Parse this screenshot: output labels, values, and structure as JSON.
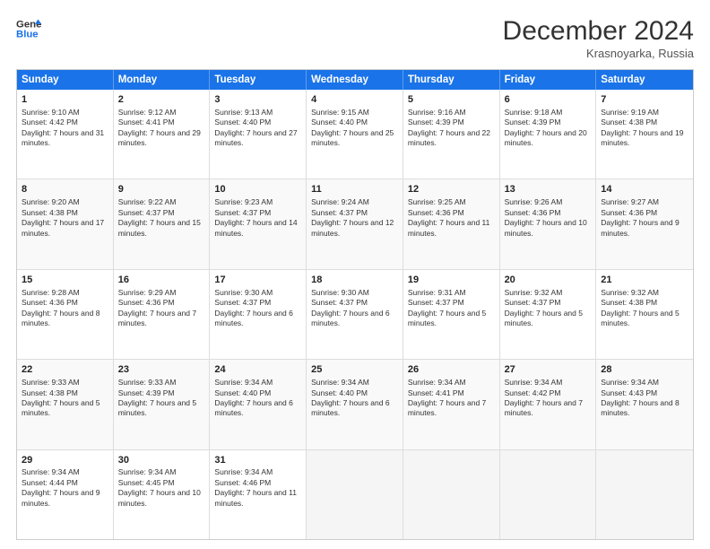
{
  "header": {
    "logo_line1": "General",
    "logo_line2": "Blue",
    "month": "December 2024",
    "location": "Krasnoyarka, Russia"
  },
  "days_of_week": [
    "Sunday",
    "Monday",
    "Tuesday",
    "Wednesday",
    "Thursday",
    "Friday",
    "Saturday"
  ],
  "weeks": [
    [
      {
        "day": "1",
        "sunrise": "Sunrise: 9:10 AM",
        "sunset": "Sunset: 4:42 PM",
        "daylight": "Daylight: 7 hours and 31 minutes."
      },
      {
        "day": "2",
        "sunrise": "Sunrise: 9:12 AM",
        "sunset": "Sunset: 4:41 PM",
        "daylight": "Daylight: 7 hours and 29 minutes."
      },
      {
        "day": "3",
        "sunrise": "Sunrise: 9:13 AM",
        "sunset": "Sunset: 4:40 PM",
        "daylight": "Daylight: 7 hours and 27 minutes."
      },
      {
        "day": "4",
        "sunrise": "Sunrise: 9:15 AM",
        "sunset": "Sunset: 4:40 PM",
        "daylight": "Daylight: 7 hours and 25 minutes."
      },
      {
        "day": "5",
        "sunrise": "Sunrise: 9:16 AM",
        "sunset": "Sunset: 4:39 PM",
        "daylight": "Daylight: 7 hours and 22 minutes."
      },
      {
        "day": "6",
        "sunrise": "Sunrise: 9:18 AM",
        "sunset": "Sunset: 4:39 PM",
        "daylight": "Daylight: 7 hours and 20 minutes."
      },
      {
        "day": "7",
        "sunrise": "Sunrise: 9:19 AM",
        "sunset": "Sunset: 4:38 PM",
        "daylight": "Daylight: 7 hours and 19 minutes."
      }
    ],
    [
      {
        "day": "8",
        "sunrise": "Sunrise: 9:20 AM",
        "sunset": "Sunset: 4:38 PM",
        "daylight": "Daylight: 7 hours and 17 minutes."
      },
      {
        "day": "9",
        "sunrise": "Sunrise: 9:22 AM",
        "sunset": "Sunset: 4:37 PM",
        "daylight": "Daylight: 7 hours and 15 minutes."
      },
      {
        "day": "10",
        "sunrise": "Sunrise: 9:23 AM",
        "sunset": "Sunset: 4:37 PM",
        "daylight": "Daylight: 7 hours and 14 minutes."
      },
      {
        "day": "11",
        "sunrise": "Sunrise: 9:24 AM",
        "sunset": "Sunset: 4:37 PM",
        "daylight": "Daylight: 7 hours and 12 minutes."
      },
      {
        "day": "12",
        "sunrise": "Sunrise: 9:25 AM",
        "sunset": "Sunset: 4:36 PM",
        "daylight": "Daylight: 7 hours and 11 minutes."
      },
      {
        "day": "13",
        "sunrise": "Sunrise: 9:26 AM",
        "sunset": "Sunset: 4:36 PM",
        "daylight": "Daylight: 7 hours and 10 minutes."
      },
      {
        "day": "14",
        "sunrise": "Sunrise: 9:27 AM",
        "sunset": "Sunset: 4:36 PM",
        "daylight": "Daylight: 7 hours and 9 minutes."
      }
    ],
    [
      {
        "day": "15",
        "sunrise": "Sunrise: 9:28 AM",
        "sunset": "Sunset: 4:36 PM",
        "daylight": "Daylight: 7 hours and 8 minutes."
      },
      {
        "day": "16",
        "sunrise": "Sunrise: 9:29 AM",
        "sunset": "Sunset: 4:36 PM",
        "daylight": "Daylight: 7 hours and 7 minutes."
      },
      {
        "day": "17",
        "sunrise": "Sunrise: 9:30 AM",
        "sunset": "Sunset: 4:37 PM",
        "daylight": "Daylight: 7 hours and 6 minutes."
      },
      {
        "day": "18",
        "sunrise": "Sunrise: 9:30 AM",
        "sunset": "Sunset: 4:37 PM",
        "daylight": "Daylight: 7 hours and 6 minutes."
      },
      {
        "day": "19",
        "sunrise": "Sunrise: 9:31 AM",
        "sunset": "Sunset: 4:37 PM",
        "daylight": "Daylight: 7 hours and 5 minutes."
      },
      {
        "day": "20",
        "sunrise": "Sunrise: 9:32 AM",
        "sunset": "Sunset: 4:37 PM",
        "daylight": "Daylight: 7 hours and 5 minutes."
      },
      {
        "day": "21",
        "sunrise": "Sunrise: 9:32 AM",
        "sunset": "Sunset: 4:38 PM",
        "daylight": "Daylight: 7 hours and 5 minutes."
      }
    ],
    [
      {
        "day": "22",
        "sunrise": "Sunrise: 9:33 AM",
        "sunset": "Sunset: 4:38 PM",
        "daylight": "Daylight: 7 hours and 5 minutes."
      },
      {
        "day": "23",
        "sunrise": "Sunrise: 9:33 AM",
        "sunset": "Sunset: 4:39 PM",
        "daylight": "Daylight: 7 hours and 5 minutes."
      },
      {
        "day": "24",
        "sunrise": "Sunrise: 9:34 AM",
        "sunset": "Sunset: 4:40 PM",
        "daylight": "Daylight: 7 hours and 6 minutes."
      },
      {
        "day": "25",
        "sunrise": "Sunrise: 9:34 AM",
        "sunset": "Sunset: 4:40 PM",
        "daylight": "Daylight: 7 hours and 6 minutes."
      },
      {
        "day": "26",
        "sunrise": "Sunrise: 9:34 AM",
        "sunset": "Sunset: 4:41 PM",
        "daylight": "Daylight: 7 hours and 7 minutes."
      },
      {
        "day": "27",
        "sunrise": "Sunrise: 9:34 AM",
        "sunset": "Sunset: 4:42 PM",
        "daylight": "Daylight: 7 hours and 7 minutes."
      },
      {
        "day": "28",
        "sunrise": "Sunrise: 9:34 AM",
        "sunset": "Sunset: 4:43 PM",
        "daylight": "Daylight: 7 hours and 8 minutes."
      }
    ],
    [
      {
        "day": "29",
        "sunrise": "Sunrise: 9:34 AM",
        "sunset": "Sunset: 4:44 PM",
        "daylight": "Daylight: 7 hours and 9 minutes."
      },
      {
        "day": "30",
        "sunrise": "Sunrise: 9:34 AM",
        "sunset": "Sunset: 4:45 PM",
        "daylight": "Daylight: 7 hours and 10 minutes."
      },
      {
        "day": "31",
        "sunrise": "Sunrise: 9:34 AM",
        "sunset": "Sunset: 4:46 PM",
        "daylight": "Daylight: 7 hours and 11 minutes."
      },
      null,
      null,
      null,
      null
    ]
  ]
}
